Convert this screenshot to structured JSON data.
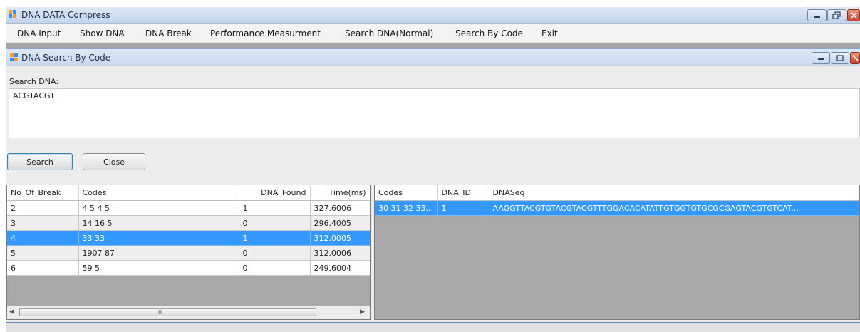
{
  "window": {
    "title": "DNA DATA Compress",
    "icon": "app-window-icon",
    "controls": [
      "minimize-icon",
      "restore-icon",
      "close-icon"
    ]
  },
  "menu": {
    "items": [
      {
        "label": "DNA Input"
      },
      {
        "label": "Show DNA"
      },
      {
        "label": "DNA Break"
      },
      {
        "label": "Performance Measurment"
      },
      {
        "label": "Search DNA(Normal)"
      },
      {
        "label": "Search By Code"
      },
      {
        "label": "Exit"
      }
    ]
  },
  "child_window": {
    "title": "DNA Search By Code",
    "icon": "app-window-icon",
    "controls": [
      "minimize-icon",
      "restore-icon",
      "close-icon"
    ],
    "search_label": "Search DNA:",
    "search_value": "ACGTACGT",
    "buttons": {
      "search": "Search",
      "close": "Close"
    }
  },
  "results_grid": {
    "columns": [
      "No_Of_Break",
      "Codes",
      "DNA_Found",
      "Time(ms)"
    ],
    "rows": [
      [
        "2",
        "4 5 4 5",
        "1",
        "327.6006"
      ],
      [
        "3",
        "14 16 5",
        "0",
        "296.4005"
      ],
      [
        "4",
        "33 33",
        "1",
        "312.0005"
      ],
      [
        "5",
        "1907 87",
        "0",
        "312.0006"
      ],
      [
        "6",
        "59 5",
        "0",
        "249.6004"
      ]
    ],
    "selected_row": 2,
    "scrollbar_grip": "III"
  },
  "detail_grid": {
    "columns": [
      "Codes",
      "DNA_ID",
      "DNASeq"
    ],
    "rows": [
      [
        "30 31 32 33...",
        "1",
        "AAGGTTACGTGTACGTACGTTTGGACACATATTGTGGTGTGCGCGAGTACGTGTCAT..."
      ]
    ],
    "selected_row": 0
  },
  "colors": {
    "selection": "#3399ff",
    "titlebar": "#c7d8ee",
    "grid_background": "#a9a9a9"
  }
}
